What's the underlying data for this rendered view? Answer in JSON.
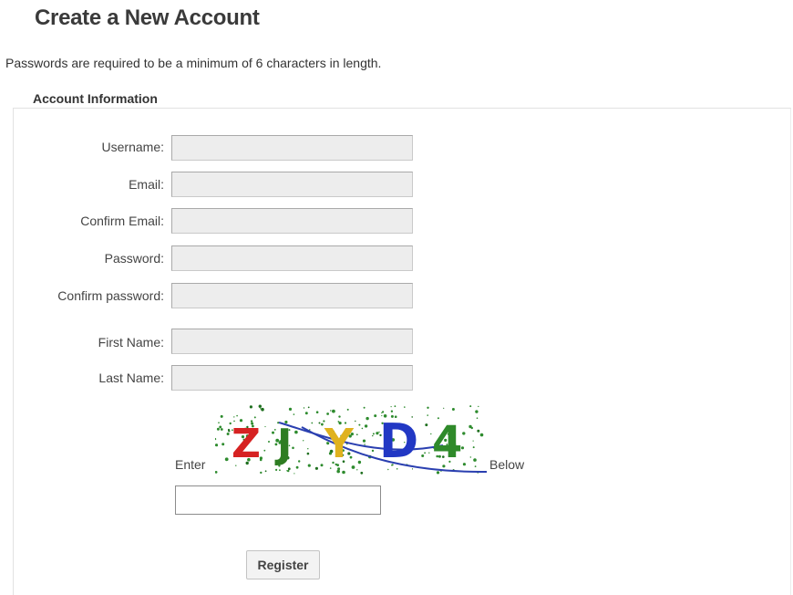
{
  "page": {
    "title": "Create a New Account",
    "password_notice": "Passwords are required to be a minimum of 6 characters in length."
  },
  "account_information": {
    "legend": "Account Information",
    "fields": [
      {
        "label": "Username:",
        "value": ""
      },
      {
        "label": "Email:",
        "value": ""
      },
      {
        "label": "Confirm Email:",
        "value": ""
      },
      {
        "label": "Password:",
        "value": ""
      },
      {
        "label": "Confirm password:",
        "value": ""
      },
      {
        "label": "First Name:",
        "value": ""
      },
      {
        "label": "Last Name:",
        "value": ""
      }
    ]
  },
  "captcha": {
    "prompt_before": "Enter",
    "prompt_after": "Below",
    "image_text": "ZJYD4",
    "letter_colors": [
      "#d62222",
      "#2e7d22",
      "#e0b21e",
      "#2238c4",
      "#2f8a2a"
    ],
    "input_value": ""
  },
  "actions": {
    "register_label": "Register"
  }
}
